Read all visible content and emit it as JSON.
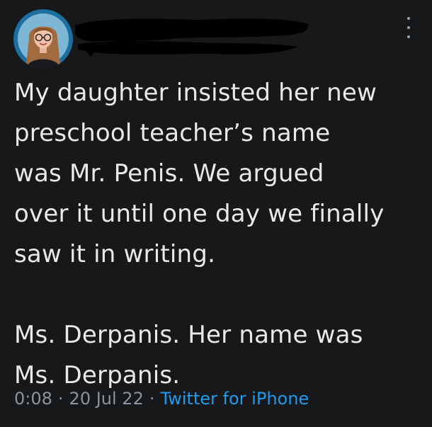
{
  "tweet": {
    "body_paragraph_1": "My daughter insisted her new\npreschool teacher’s name\nwas Mr. Penis. We argued\nover it until one day we finally\nsaw it in writing.",
    "body_paragraph_2": "Ms. Derpanis. Her name was\nMs. Derpanis.",
    "time": "0:08",
    "separator": "·",
    "date": "20 Jul 22",
    "source": "Twitter for iPhone"
  },
  "colors": {
    "background": "#16181a",
    "text": "#e7e9ea",
    "muted": "#8b949e",
    "link": "#1d9bf0",
    "avatar_ring": "#1d6fa0"
  },
  "icons": {
    "avatar": "profile-photo",
    "more": "more-vertical-icon"
  }
}
